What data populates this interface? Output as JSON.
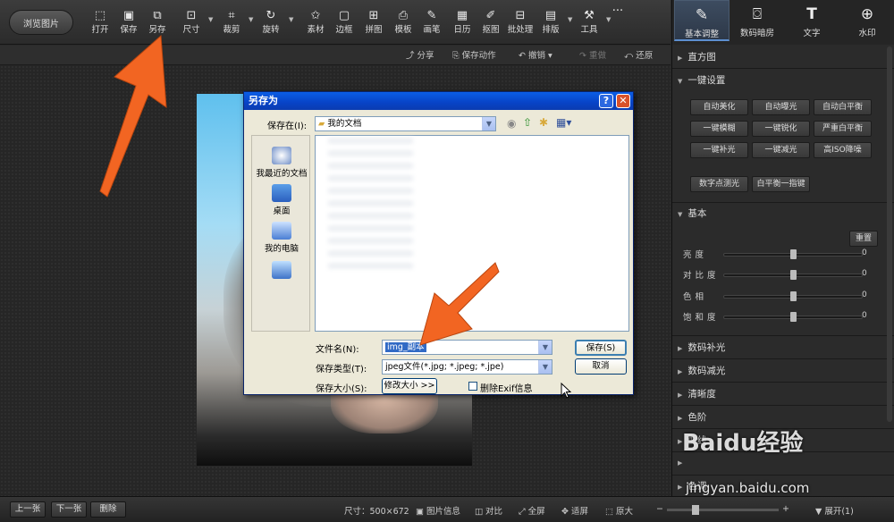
{
  "toolbar": {
    "browse_label": "浏览图片",
    "tools": [
      {
        "label": "打开",
        "icon": "open-icon"
      },
      {
        "label": "保存",
        "icon": "save-icon"
      },
      {
        "label": "另存",
        "icon": "save-as-icon"
      },
      {
        "label": "尺寸",
        "icon": "resize-icon"
      },
      {
        "label": "裁剪",
        "icon": "crop-icon"
      },
      {
        "label": "旋转",
        "icon": "rotate-icon"
      },
      {
        "label": "素材",
        "icon": "material-icon"
      },
      {
        "label": "边框",
        "icon": "border-icon"
      },
      {
        "label": "拼图",
        "icon": "collage-icon"
      },
      {
        "label": "模板",
        "icon": "template-icon"
      },
      {
        "label": "画笔",
        "icon": "brush-icon"
      },
      {
        "label": "日历",
        "icon": "calendar-icon"
      },
      {
        "label": "抠图",
        "icon": "cutout-icon"
      },
      {
        "label": "批处理",
        "icon": "batch-icon"
      },
      {
        "label": "排版",
        "icon": "layout-icon"
      },
      {
        "label": "工具",
        "icon": "tools-icon"
      }
    ],
    "more": "···"
  },
  "tabs": [
    {
      "label": "基本调整",
      "icon": "adjust-icon",
      "active": true
    },
    {
      "label": "数码暗房",
      "icon": "camera-icon",
      "active": false
    },
    {
      "label": "文字",
      "icon": "text-icon",
      "active": false
    },
    {
      "label": "水印",
      "icon": "watermark-icon",
      "active": false
    }
  ],
  "subbar": {
    "share": "分享",
    "save_action": "保存动作",
    "undo": "撤销",
    "redo": "重做",
    "restore": "还原"
  },
  "dialog": {
    "title": "另存为",
    "save_in_label": "保存在(I):",
    "save_in_value": "我的文档",
    "places": [
      "我最近的文档",
      "桌面",
      "我的电脑",
      ""
    ],
    "filename_label": "文件名(N):",
    "filename_value": "img_副本",
    "filetype_label": "保存类型(T):",
    "filetype_value": "jpeg文件(*.jpg; *.jpeg; *.jpe)",
    "filesize_label": "保存大小(S):",
    "resize_button": "修改大小 >>",
    "delete_exif_label": "删除Exif信息",
    "save_button": "保存(S)",
    "cancel_button": "取消"
  },
  "panel": {
    "histogram": "直方图",
    "oneclick": "一键设置",
    "oneclick_buttons": [
      "自动美化",
      "自动曝光",
      "自动白平衡",
      "一键模糊",
      "一键锐化",
      "严重白平衡",
      "一键补光",
      "一键减光",
      "高ISO降噪"
    ],
    "digital_buttons": [
      "数字点测光",
      "白平衡一指键"
    ],
    "basic": "基本",
    "reset": "重置",
    "sliders": [
      {
        "label": "亮度",
        "value": "0"
      },
      {
        "label": "对比度",
        "value": "0"
      },
      {
        "label": "色相",
        "value": "0"
      },
      {
        "label": "饱和度",
        "value": "0"
      }
    ],
    "collapsed_sections": [
      "数码补光",
      "数码减光",
      "清晰度",
      "色阶",
      "曲线",
      "",
      "色调"
    ]
  },
  "bottom": {
    "prev": "上一张",
    "next": "下一张",
    "delete": "删除",
    "size_label": "尺寸：500×672",
    "image_info": "图片信息",
    "compare": "对比",
    "fullscreen": "全屏",
    "fit": "适屏",
    "original": "原大",
    "expand": "展开(1)"
  },
  "watermark": {
    "text": "Baidu经验",
    "url": "jingyan.baidu.com"
  },
  "colors": {
    "arrow": "#f26522",
    "accent": "#5d8fd0",
    "dialog_title": "#0a5ee6"
  }
}
